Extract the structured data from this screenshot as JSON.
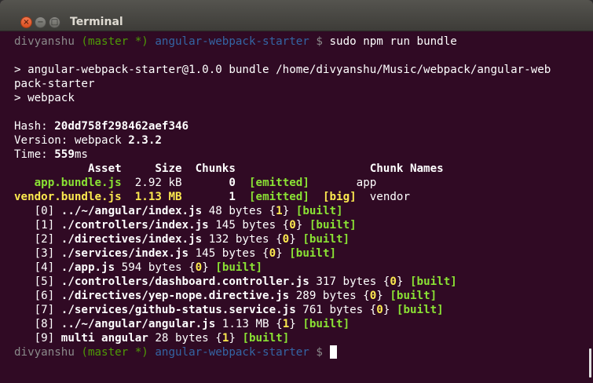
{
  "window": {
    "title": "Terminal"
  },
  "prompt": {
    "user": "divyanshu",
    "branch": "(master *)",
    "dir": "angular-webpack-starter",
    "symbol": "$"
  },
  "command": "sudo npm run bundle",
  "script_header": [
    "> angular-webpack-starter@1.0.0 bundle /home/divyanshu/Music/webpack/angular-web",
    "pack-starter",
    "> webpack"
  ],
  "stats": {
    "hash_label": "Hash:",
    "hash": "20dd758f298462aef346",
    "version_label": "Version: webpack",
    "version": "2.3.2",
    "time_label": "Time:",
    "time": "559",
    "time_unit": "ms"
  },
  "assets_table": {
    "header": {
      "asset": "Asset",
      "size": "Size",
      "chunks": "Chunks",
      "chunk_names": "Chunk Names"
    },
    "rows": [
      {
        "name": "app.bundle.js",
        "size": "2.92 kB",
        "chunks": "0",
        "emitted": "[emitted]",
        "big": "",
        "chunk_name": "app"
      },
      {
        "name": "vendor.bundle.js",
        "size": "1.13 MB",
        "chunks": "1",
        "emitted": "[emitted]",
        "big": "[big]",
        "chunk_name": "vendor"
      }
    ]
  },
  "modules": [
    {
      "idx": "[0]",
      "path": "../~/angular/index.js",
      "size": "48 bytes",
      "chunk": "1",
      "status": "[built]"
    },
    {
      "idx": "[1]",
      "path": "./controllers/index.js",
      "size": "145 bytes",
      "chunk": "0",
      "status": "[built]"
    },
    {
      "idx": "[2]",
      "path": "./directives/index.js",
      "size": "132 bytes",
      "chunk": "0",
      "status": "[built]"
    },
    {
      "idx": "[3]",
      "path": "./services/index.js",
      "size": "145 bytes",
      "chunk": "0",
      "status": "[built]"
    },
    {
      "idx": "[4]",
      "path": "./app.js",
      "size": "594 bytes",
      "chunk": "0",
      "status": "[built]"
    },
    {
      "idx": "[5]",
      "path": "./controllers/dashboard.controller.js",
      "size": "317 bytes",
      "chunk": "0",
      "status": "[built]"
    },
    {
      "idx": "[6]",
      "path": "./directives/yep-nope.directive.js",
      "size": "289 bytes",
      "chunk": "0",
      "status": "[built]"
    },
    {
      "idx": "[7]",
      "path": "./services/github-status.service.js",
      "size": "761 bytes",
      "chunk": "0",
      "status": "[built]"
    },
    {
      "idx": "[8]",
      "path": "../~/angular/angular.js",
      "size": "1.13 MB",
      "chunk": "1",
      "status": "[built]"
    },
    {
      "idx": "[9]",
      "path": "multi angular",
      "size": "28 bytes",
      "chunk": "1",
      "status": "[built]"
    }
  ],
  "colors": {
    "background": "#300a24",
    "green": "#8ae234",
    "yellow": "#fce94f",
    "dir_blue": "#3465a4",
    "branch_green": "#4e9a06"
  },
  "icons": {
    "close": "close-icon",
    "minimize": "minimize-icon",
    "maximize": "maximize-icon"
  }
}
